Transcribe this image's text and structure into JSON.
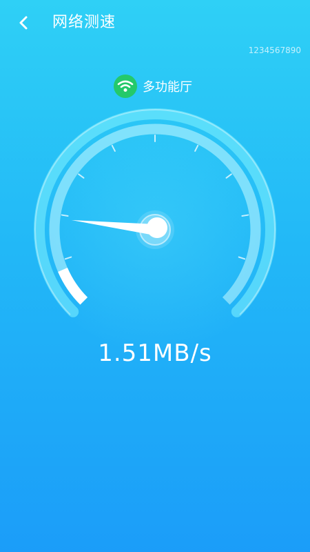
{
  "header": {
    "title": "网络测速",
    "back_icon": "chevron-left-icon"
  },
  "device_id": "1234567890",
  "network": {
    "name": "多功能厅",
    "icon": "wifi-icon",
    "icon_bg": "#24c96a"
  },
  "gauge": {
    "progress": 0.08
  },
  "speed": {
    "text": "1.51MB/s"
  },
  "colors": {
    "background_top": "#2fd0f6",
    "background_bottom": "#1b9df9",
    "text": "#ffffff"
  }
}
